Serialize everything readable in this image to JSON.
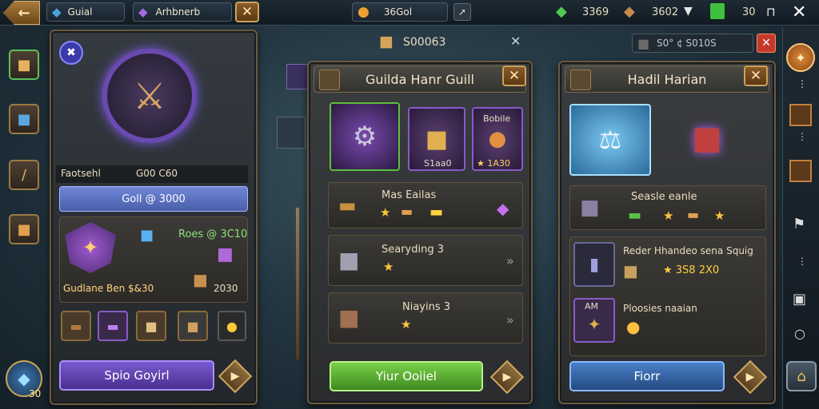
{
  "topbar": {
    "back_icon": "back-arrow-icon",
    "guild_tab": "Guial",
    "second_tab": "Arhbnerb",
    "gold": "36Gol",
    "gem_a": "3369",
    "gem_b": "3602",
    "gem_c": "30"
  },
  "left_panel": {
    "label_left": "Faotsehl",
    "label_right": "G00 C60",
    "gold_bar": "Goll @ 3000",
    "reward_text": "Roes @ 3C10",
    "guild_line": "Gudlane Ben $&30",
    "count": "2030",
    "action_button": "Spio Goyirl"
  },
  "middle_header": {
    "price": "S00063"
  },
  "guild_panel": {
    "title": "Guilda Hanr Guill",
    "card3_label": "Bobile",
    "card2_value": "S1aa0",
    "card3_value": "★ 1A30",
    "row1_label": "Mas Eailas",
    "row2_label": "Searyding 3",
    "row3_label": "Niayins 3",
    "action_button": "Yiur Ooiiel"
  },
  "right_header": {
    "price": "S0° ¢ S010S"
  },
  "harian_panel": {
    "title": "Hadil Harian",
    "row1_label": "Seasle eanle",
    "row2_label": "Reder Hhandeo sena Squig",
    "row2_value": "★ 3S8 2X0",
    "row3_icon_label": "AM",
    "row3_label": "Ploosies naaian",
    "action_button": "Fiorr"
  },
  "left_bottom": {
    "badge": "30"
  },
  "colors": {
    "gold": "#ffc83a",
    "green_button": "#5aa82a",
    "blue_button": "#2f5f9a",
    "purple_button": "#6a4aa8",
    "close_button": "#8a5a2a"
  }
}
